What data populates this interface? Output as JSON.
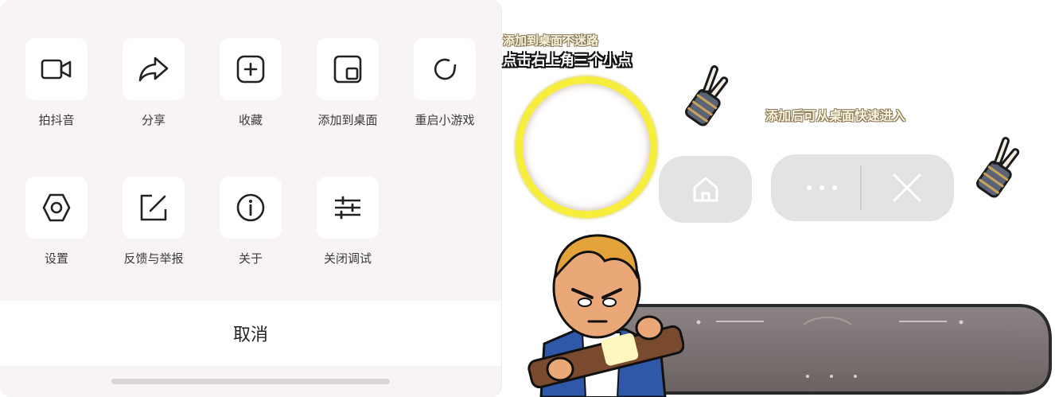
{
  "sheet": {
    "row1": [
      {
        "label": "拍抖音",
        "icon": "video-camera-icon"
      },
      {
        "label": "分享",
        "icon": "share-icon"
      },
      {
        "label": "收藏",
        "icon": "add-favorite-icon"
      },
      {
        "label": "添加到桌面",
        "icon": "add-to-desktop-icon"
      },
      {
        "label": "重启小游戏",
        "icon": "restart-icon"
      }
    ],
    "row2": [
      {
        "label": "设置",
        "icon": "settings-icon"
      },
      {
        "label": "反馈与举报",
        "icon": "feedback-icon"
      },
      {
        "label": "关于",
        "icon": "info-icon"
      },
      {
        "label": "关闭调试",
        "icon": "sliders-icon"
      }
    ],
    "cancel_label": "取消"
  },
  "overlay": {
    "hint_top": "添加到桌面不迷路",
    "hint_main": "点击右上角三个小点",
    "hint_side": "添加后可从桌面快速进入"
  },
  "colors": {
    "sheet_bg": "#f8f4f4",
    "tile_bg": "#ffffff",
    "ring": "#f7ee3c",
    "pill_bg": "#e3e3e3"
  }
}
